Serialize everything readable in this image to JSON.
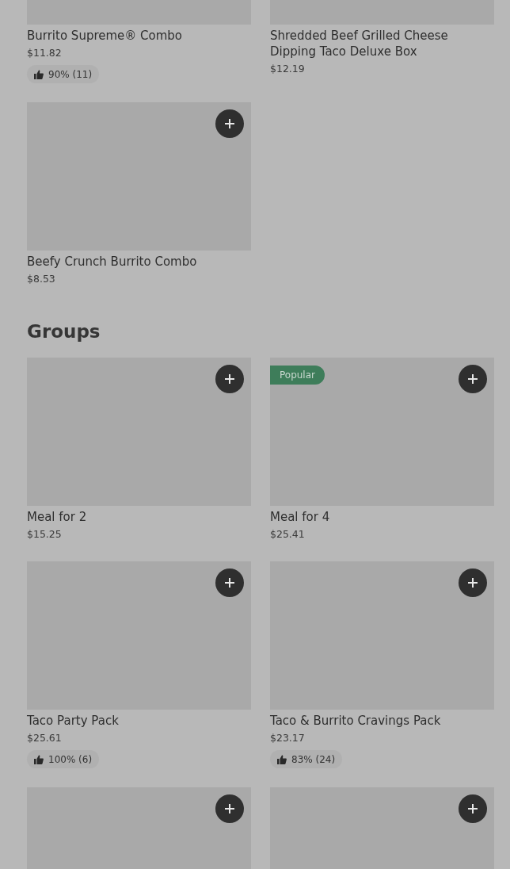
{
  "sections": [
    {
      "rows": [
        {
          "items": [
            {
              "name": "Burrito Supreme® Combo",
              "price": "$11.82",
              "rating": "90% (11)",
              "add_button": false
            },
            {
              "name": "Shredded Beef Grilled Cheese Dipping Taco Deluxe Box",
              "price": "$12.19",
              "add_button": false
            }
          ]
        },
        {
          "items": [
            {
              "name": "Beefy Crunch Burrito Combo",
              "price": "$8.53",
              "add_button": true
            }
          ]
        }
      ]
    },
    {
      "title": "Groups",
      "rows": [
        {
          "items": [
            {
              "name": "Meal for 2",
              "price": "$15.25",
              "add_button": true
            },
            {
              "name": "Meal for 4",
              "price": "$25.41",
              "badge": "Popular",
              "add_button": true
            }
          ]
        },
        {
          "items": [
            {
              "name": "Taco Party Pack",
              "price": "$25.61",
              "rating": "100% (6)",
              "add_button": true
            },
            {
              "name": "Taco & Burrito Cravings Pack",
              "price": "$23.17",
              "rating": "83% (24)",
              "add_button": true
            }
          ]
        },
        {
          "items": [
            {
              "add_button": true
            },
            {
              "add_button": true
            }
          ]
        }
      ]
    }
  ]
}
